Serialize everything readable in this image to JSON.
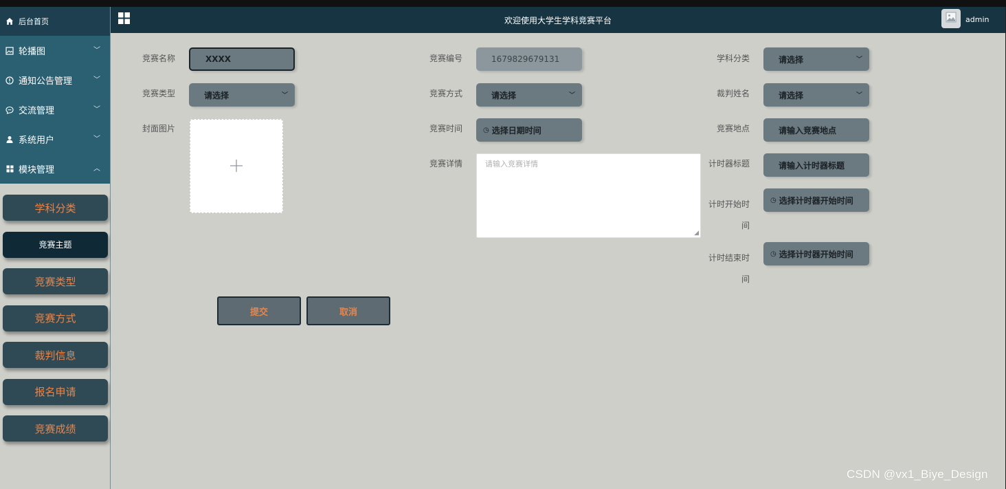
{
  "header": {
    "title": "欢迎使用大学生学科竞赛平台",
    "user": "admin",
    "menu_icon": "grid-icon",
    "avatar_icon": "image-icon"
  },
  "sidebar": {
    "home": {
      "label": "后台首页",
      "icon": "home-icon"
    },
    "menus": [
      {
        "label": "轮播图",
        "icon": "picture-icon",
        "chevron": "chevron-down-icon"
      },
      {
        "label": "通知公告管理",
        "icon": "info-icon",
        "chevron": "chevron-down-icon"
      },
      {
        "label": "交流管理",
        "icon": "chat-icon",
        "chevron": "chevron-down-icon"
      },
      {
        "label": "系统用户",
        "icon": "user-icon",
        "chevron": "chevron-down-icon"
      },
      {
        "label": "模块管理",
        "icon": "grid-icon",
        "chevron": "chevron-up-icon"
      }
    ],
    "submenu": [
      {
        "label": "学科分类"
      },
      {
        "label": "竞赛主题",
        "active": true
      },
      {
        "label": "竞赛类型"
      },
      {
        "label": "竞赛方式"
      },
      {
        "label": "裁判信息"
      },
      {
        "label": "报名申请"
      },
      {
        "label": "竞赛成绩"
      }
    ]
  },
  "form": {
    "name": {
      "label": "竞赛名称",
      "value": "XXXX"
    },
    "number": {
      "label": "竞赛编号",
      "value": "1679829679131"
    },
    "category": {
      "label": "学科分类",
      "placeholder": "请选择"
    },
    "type": {
      "label": "竞赛类型",
      "placeholder": "请选择"
    },
    "method": {
      "label": "竞赛方式",
      "placeholder": "请选择"
    },
    "judge": {
      "label": "裁判姓名",
      "placeholder": "请选择"
    },
    "cover": {
      "label": "封面图片",
      "icon": "plus-icon"
    },
    "time": {
      "label": "竞赛时间",
      "placeholder": "选择日期时间"
    },
    "location": {
      "label": "竞赛地点",
      "placeholder": "请输入竞赛地点"
    },
    "details": {
      "label": "竞赛详情",
      "placeholder": "请输入竞赛详情"
    },
    "timer_title": {
      "label": "计时器标题",
      "placeholder": "请输入计时器标题"
    },
    "timer_start": {
      "label_line1": "计时开始时",
      "label_line2": "间",
      "placeholder": "选择计时器开始时间"
    },
    "timer_end": {
      "label_line1": "计时结束时",
      "label_line2": "间",
      "placeholder": "选择计时器开始时间"
    },
    "submit_label": "提交",
    "cancel_label": "取消"
  },
  "watermark": "CSDN @vx1_Biye_Design",
  "colors": {
    "sidebar_menu": "#2b5f72",
    "sidebar_home": "#1d3f4f",
    "header": "#163442",
    "accent_text": "#e8854a",
    "field_bg": "#6b7a80",
    "page_bg": "#cfcfca"
  }
}
